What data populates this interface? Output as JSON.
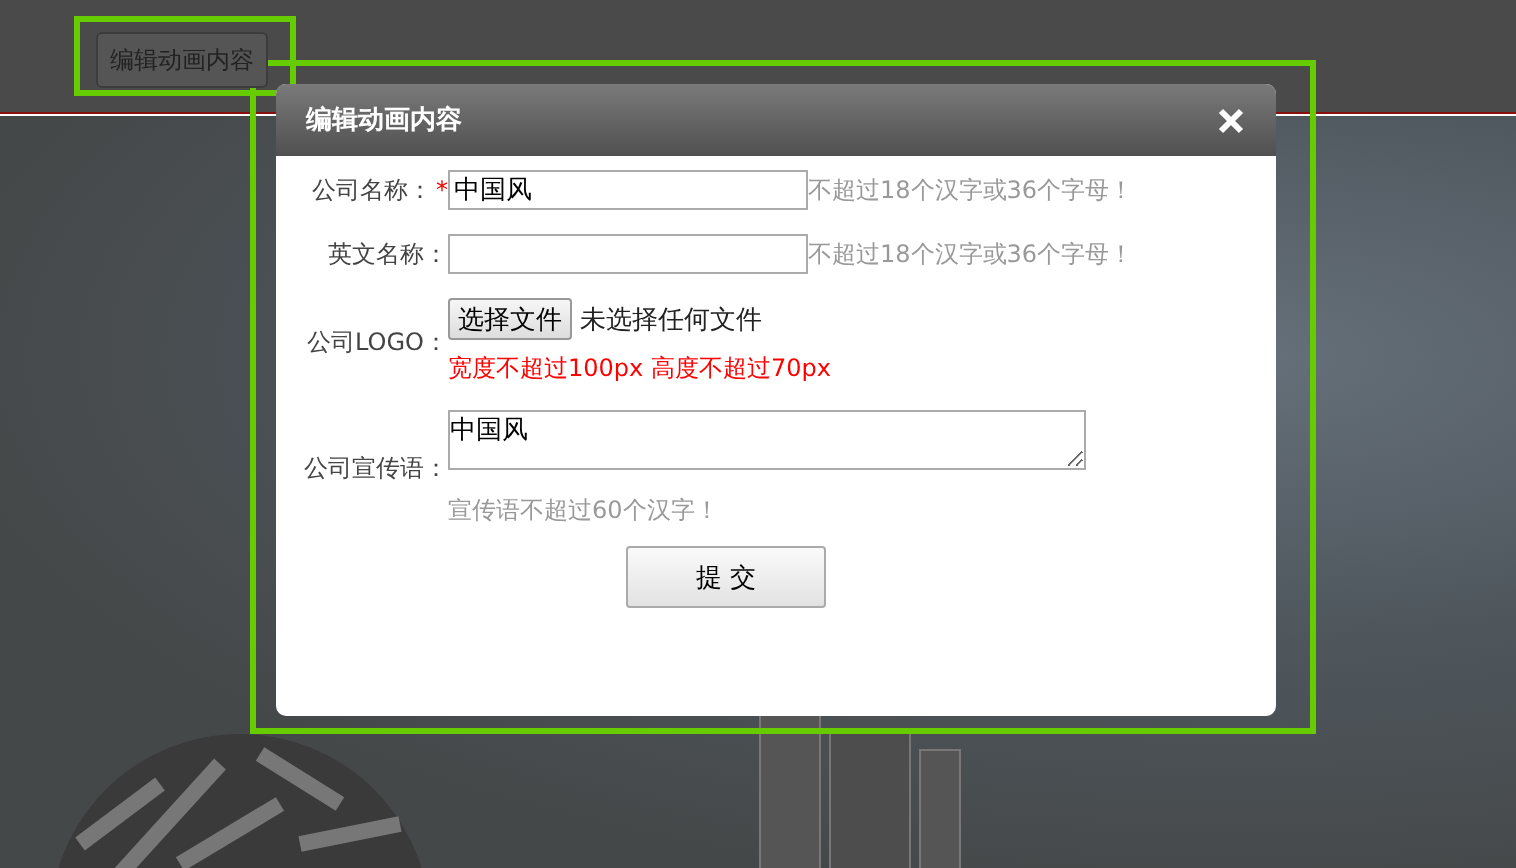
{
  "top_button": {
    "label": "编辑动画内容"
  },
  "dialog": {
    "title": "编辑动画内容",
    "fields": [
      {
        "kind": "text",
        "label": "公司名称：",
        "required": true,
        "required_mark": "*",
        "value": "中国风",
        "hint": "不超过18个汉字或36个字母！"
      },
      {
        "kind": "text",
        "label": "英文名称：",
        "required": false,
        "hint": "不超过18个汉字或36个字母！"
      },
      {
        "kind": "file",
        "label": "公司LOGO：",
        "required": false,
        "button": "选择文件",
        "status": "未选择任何文件",
        "note": "宽度不超过100px 高度不超过70px"
      },
      {
        "kind": "textarea",
        "label": "公司宣传语：",
        "required": false,
        "value": "中国风",
        "hint": "宣传语不超过60个汉字！"
      }
    ],
    "submit": "提 交"
  }
}
